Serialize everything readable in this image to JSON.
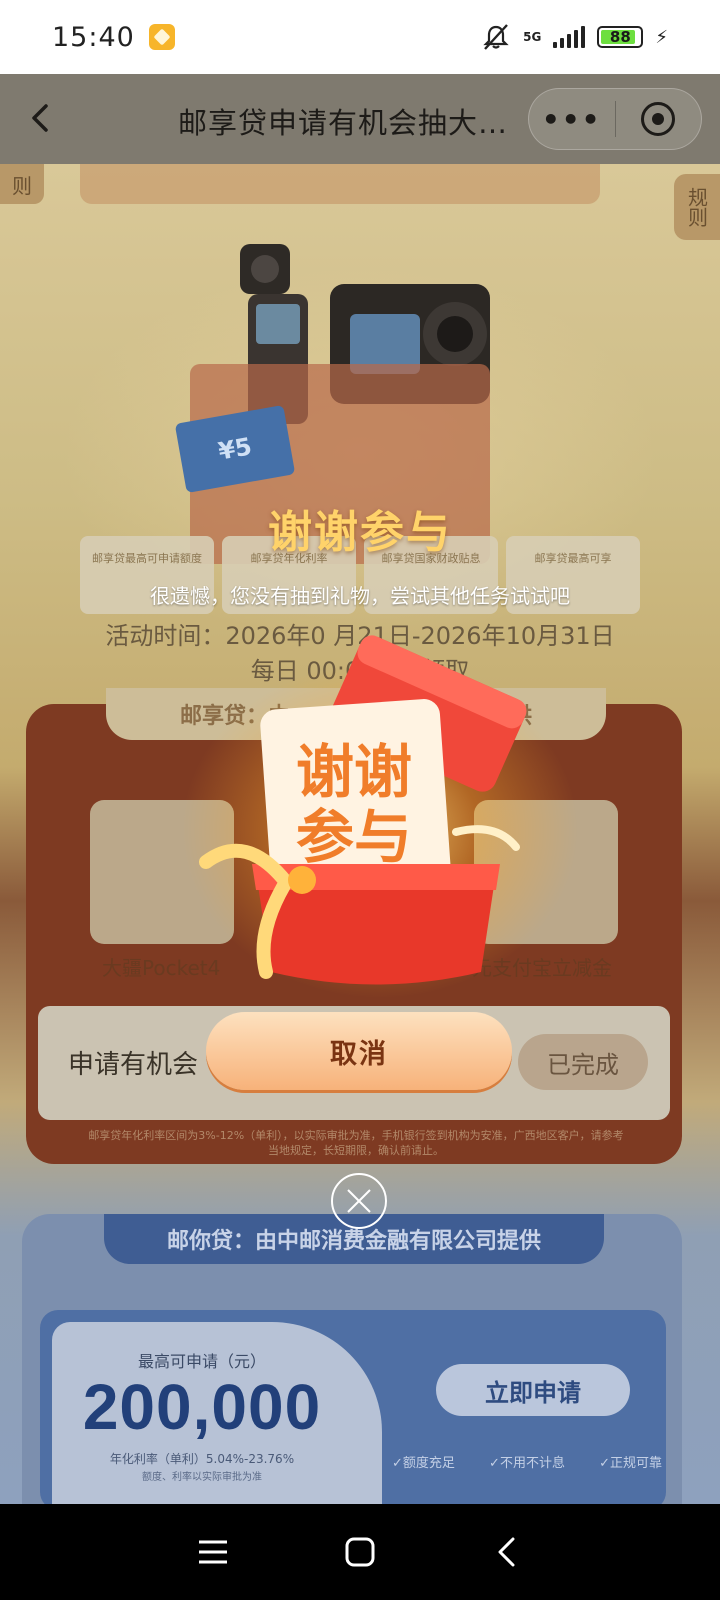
{
  "status_bar": {
    "time": "15:40",
    "network": "5G",
    "battery": "88"
  },
  "nav": {
    "title": "邮享贷申请有机会抽大…",
    "more_label": "•••"
  },
  "page": {
    "rule_label_left": "则",
    "rule_label_right": "规则",
    "coupon_value": "¥5",
    "stats": [
      "邮享贷最高可申请额度",
      "邮享贷年化利率",
      "邮享贷国家财政贴息",
      "邮享贷最高可享"
    ],
    "activity_time": "活动时间：2026年0 月21日-2026年10月31日",
    "activity_daily": "每日 00:00          59 领取",
    "red_panel": {
      "tab": "邮享贷：由",
      "tab_suffix": "供",
      "products": [
        {
          "label": "大疆Pocket4"
        },
        {
          "label": "元支付宝立减金"
        }
      ],
      "apply_label": "申请有机会",
      "done_label": "已完成",
      "footnote": "邮享贷年化利率区间为3%-12%（单利），以实际审批为准，手机银行签到机构为安准，广西地区客户，请参考当地规定，长短期限，确认前请止。"
    },
    "blue_panel": {
      "tab": "邮你贷：由中邮消费金融有限公司提供",
      "max_label": "最高可申请（元）",
      "amount": "200,000",
      "rate": "年化利率（单利）5.04%-23.76%",
      "rate_note": "额度、利率以实际审批为准",
      "apply_now": "立即申请",
      "features": [
        "✓额度充足",
        "✓不用不计息",
        "✓正规可靠"
      ]
    }
  },
  "modal": {
    "title": "谢谢参与",
    "subtitle": "很遗憾，您没有抽到礼物，尝试其他任务试试吧",
    "card_text_line1": "谢谢",
    "card_text_line2": "参与",
    "cancel_label": "取消"
  },
  "colors": {
    "modal_title": "#ffd36a",
    "cancel_button": "#f7b27a",
    "gift_red": "#e8382a"
  }
}
